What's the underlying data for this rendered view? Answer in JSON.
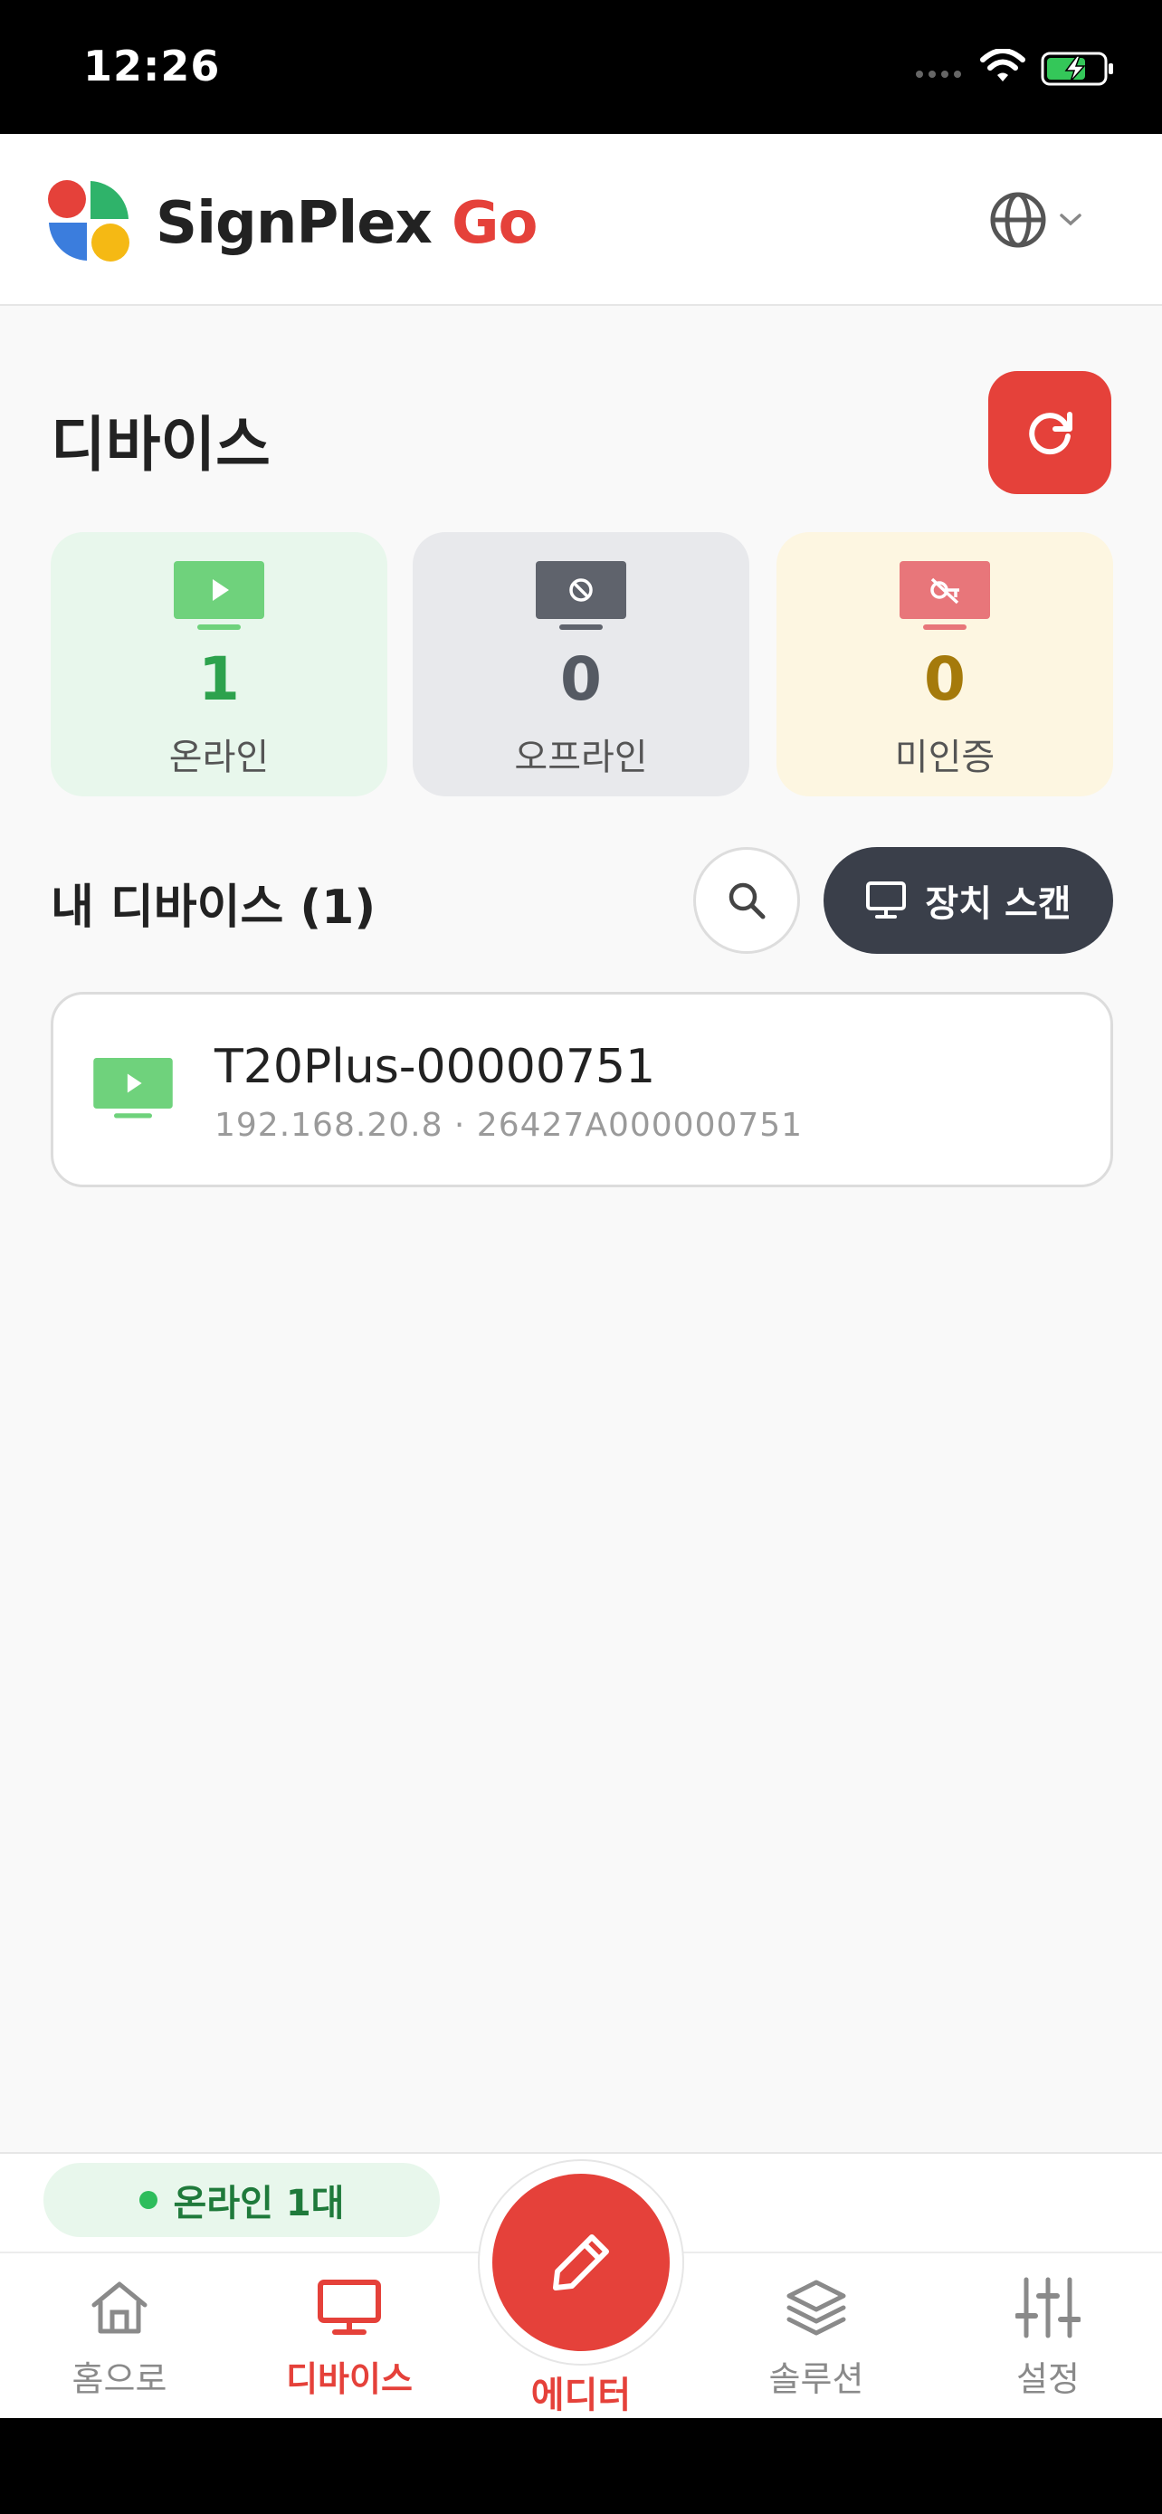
{
  "status_bar": {
    "time": "12:26"
  },
  "header": {
    "brand_name": "SignPlex",
    "brand_suffix": "Go"
  },
  "page": {
    "title": "디바이스"
  },
  "stats": [
    {
      "value": "1",
      "label": "온라인"
    },
    {
      "value": "0",
      "label": "오프라인"
    },
    {
      "value": "0",
      "label": "미인증"
    }
  ],
  "my_devices": {
    "title": "내 디바이스 (1)",
    "scan_label": "장치 스캔",
    "items": [
      {
        "name": "T20Plus-00000751",
        "meta": "192.168.20.8  ·  26427A000000751"
      }
    ]
  },
  "online_pill": {
    "label": "온라인 1대"
  },
  "tabs": {
    "home": "홈으로",
    "devices": "디바이스",
    "editor": "에디터",
    "solutions": "솔루션",
    "settings": "설정"
  },
  "colors": {
    "accent": "#e5413a",
    "online": "#2da24d",
    "offline": "#555a63",
    "unauthorized": "#a57a0b",
    "dark_button": "#3a3f4a"
  }
}
